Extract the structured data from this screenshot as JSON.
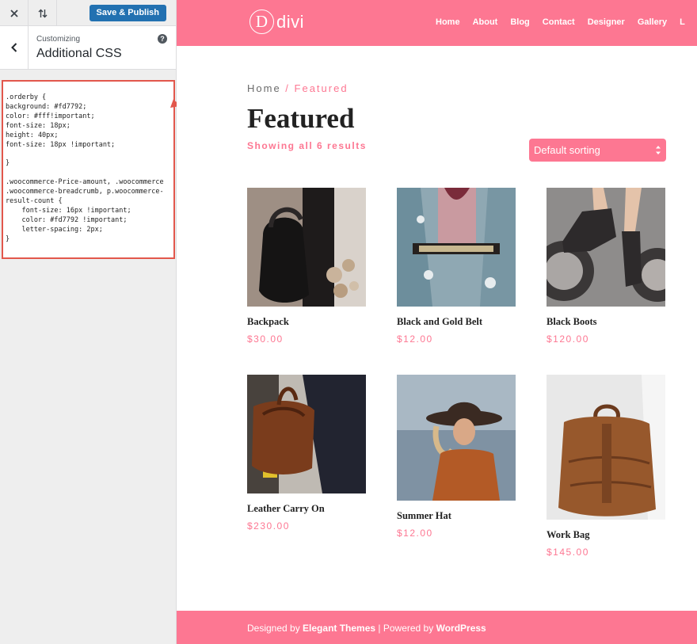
{
  "customizer": {
    "close_icon": "close-icon",
    "sort_icon": "device-toggle-icon",
    "publish_label": "Save & Publish",
    "back_icon": "chevron-left-icon",
    "section_sub": "Customizing",
    "section_title": "Additional CSS",
    "help_icon": "help-icon",
    "help_glyph": "?",
    "css_code": ".orderby {\nbackground: #fd7792;\ncolor: #fff!important;\nfont-size: 18px;\nheight: 40px;\nfont-size: 18px !important;\n\n}\n\n.woocommerce-Price-amount, .woocommerce\n.woocommerce-breadcrumb, p.woocommerce-\nresult-count {\n    font-size: 16px !important;\n    color: #fd7792 !important;\n    letter-spacing: 2px;\n}"
  },
  "site": {
    "logo_letter": "D",
    "logo_text": "divi",
    "nav": [
      "Home",
      "About",
      "Blog",
      "Contact",
      "Designer",
      "Gallery",
      "L"
    ],
    "breadcrumb": {
      "home": "Home",
      "sep": " / ",
      "current": "Featured"
    },
    "page_title": "Featured",
    "result_count": "Showing all 6 results",
    "orderby": "Default sorting",
    "products": [
      {
        "name": "Backpack",
        "price": "$30.00"
      },
      {
        "name": "Black and Gold Belt",
        "price": "$12.00"
      },
      {
        "name": "Black Boots",
        "price": "$120.00"
      },
      {
        "name": "Leather Carry On",
        "price": "$230.00"
      },
      {
        "name": "Summer Hat",
        "price": "$12.00"
      },
      {
        "name": "Work Bag",
        "price": "$145.00"
      }
    ],
    "footer": {
      "designed_by": "Designed by ",
      "elegant": "Elegant Themes",
      "powered": " | Powered by ",
      "wordpress": "WordPress"
    }
  },
  "colors": {
    "accent": "#fd7792",
    "publish": "#2271b1",
    "annotation": "#e2574c"
  }
}
